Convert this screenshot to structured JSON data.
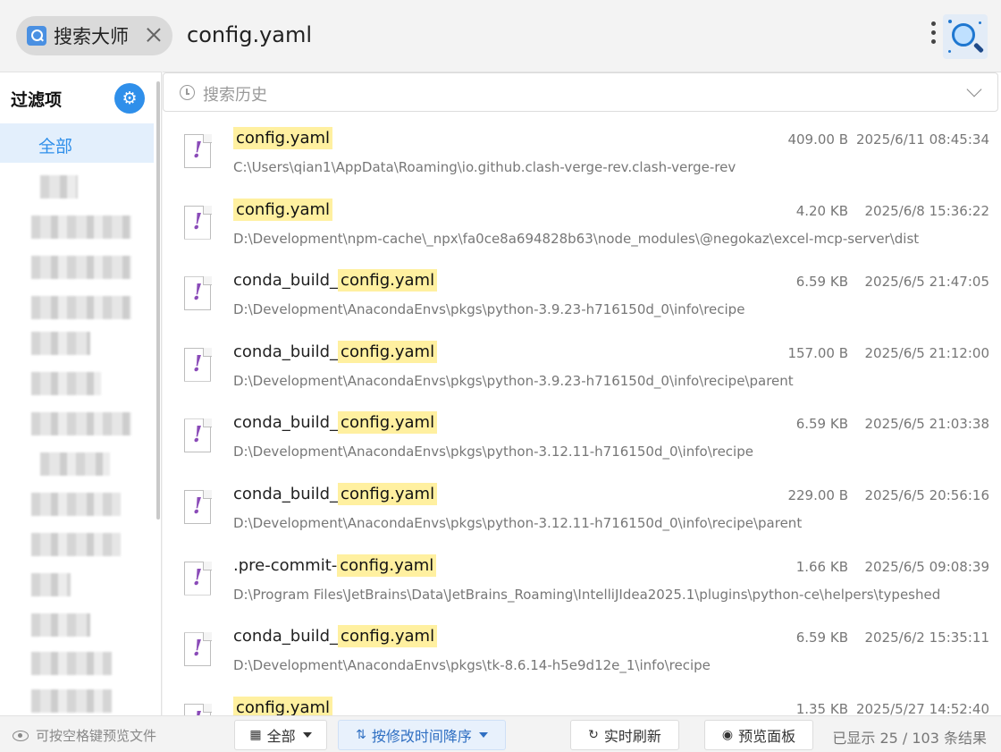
{
  "tab": {
    "label": "搜索大师",
    "icon": "search-app-icon"
  },
  "query": "config.yaml",
  "sidebar": {
    "title": "过滤项",
    "settings_icon": "gear-icon",
    "active_item": "全部"
  },
  "search_history": {
    "placeholder": "搜索历史"
  },
  "highlight_color": "#fff0a0",
  "accent_color": "#2f8fea",
  "results": [
    {
      "prefix": "",
      "match": "config.yaml",
      "suffix": "",
      "size": "409.00 B",
      "date": "2025/6/11 08:45:34",
      "path": "C:\\Users\\qian1\\AppData\\Roaming\\io.github.clash-verge-rev.clash-verge-rev"
    },
    {
      "prefix": "",
      "match": "config.yaml",
      "suffix": "",
      "size": "4.20 KB",
      "date": "2025/6/8 15:36:22",
      "path": "D:\\Development\\npm-cache\\_npx\\fa0ce8a694828b63\\node_modules\\@negokaz\\excel-mcp-server\\dist"
    },
    {
      "prefix": "conda_build_",
      "match": "config.yaml",
      "suffix": "",
      "size": "6.59 KB",
      "date": "2025/6/5 21:47:05",
      "path": "D:\\Development\\AnacondaEnvs\\pkgs\\python-3.9.23-h716150d_0\\info\\recipe"
    },
    {
      "prefix": "conda_build_",
      "match": "config.yaml",
      "suffix": "",
      "size": "157.00 B",
      "date": "2025/6/5 21:12:00",
      "path": "D:\\Development\\AnacondaEnvs\\pkgs\\python-3.9.23-h716150d_0\\info\\recipe\\parent"
    },
    {
      "prefix": "conda_build_",
      "match": "config.yaml",
      "suffix": "",
      "size": "6.59 KB",
      "date": "2025/6/5 21:03:38",
      "path": "D:\\Development\\AnacondaEnvs\\pkgs\\python-3.12.11-h716150d_0\\info\\recipe"
    },
    {
      "prefix": "conda_build_",
      "match": "config.yaml",
      "suffix": "",
      "size": "229.00 B",
      "date": "2025/6/5 20:56:16",
      "path": "D:\\Development\\AnacondaEnvs\\pkgs\\python-3.12.11-h716150d_0\\info\\recipe\\parent"
    },
    {
      "prefix": ".pre-commit-",
      "match": "config.yaml",
      "suffix": "",
      "size": "1.66 KB",
      "date": "2025/6/5 09:08:39",
      "path": "D:\\Program Files\\JetBrains\\Data\\JetBrains_Roaming\\IntelliJIdea2025.1\\plugins\\python-ce\\helpers\\typeshed"
    },
    {
      "prefix": "conda_build_",
      "match": "config.yaml",
      "suffix": "",
      "size": "6.59 KB",
      "date": "2025/6/2 15:35:11",
      "path": "D:\\Development\\AnacondaEnvs\\pkgs\\tk-8.6.14-h5e9d12e_1\\info\\recipe"
    },
    {
      "prefix": "",
      "match": "config.yaml",
      "suffix": "",
      "size": "1.35 KB",
      "date": "2025/5/27 14:52:40",
      "path": ""
    }
  ],
  "status": {
    "hint": "可按空格键预览文件",
    "filter_label": "全部",
    "sort_label": "按修改时间降序",
    "refresh_label": "实时刷新",
    "preview_label": "预览面板",
    "count": "已显示 25 / 103 条结果"
  }
}
